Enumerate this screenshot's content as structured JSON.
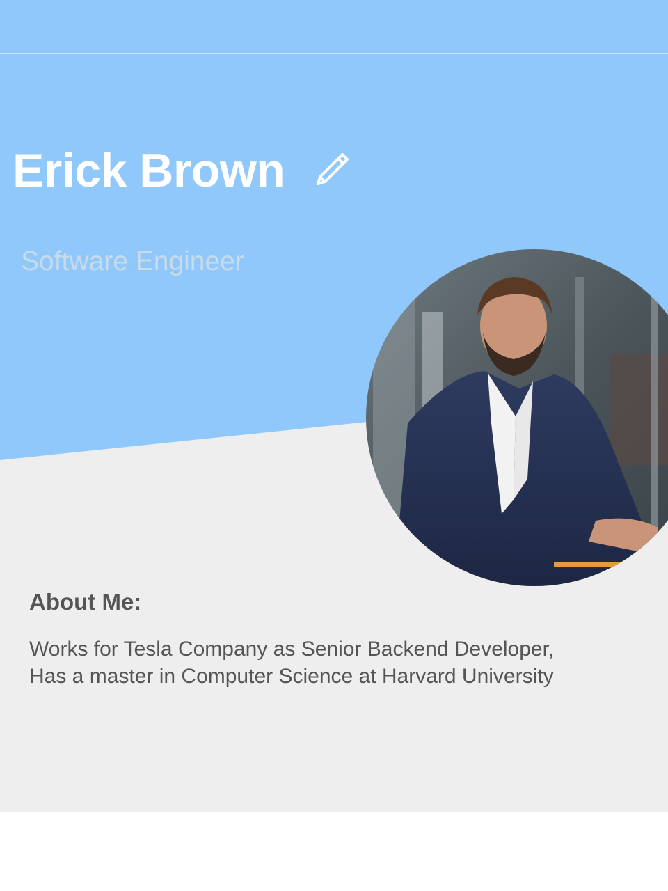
{
  "profile": {
    "name": "Erick Brown",
    "title": "Software Engineer"
  },
  "about": {
    "heading": "About Me:",
    "lines": [
      "Works for Tesla Company as Senior Backend Developer,",
      "Has a master in Computer Science at Harvard University"
    ]
  },
  "colors": {
    "header": "#90c8fb",
    "card_background": "#eeeeee",
    "page_background": "#ffffff",
    "body_text": "#555555",
    "subtitle_text": "#c8dbe9"
  },
  "icons": {
    "edit": "pencil-icon"
  }
}
